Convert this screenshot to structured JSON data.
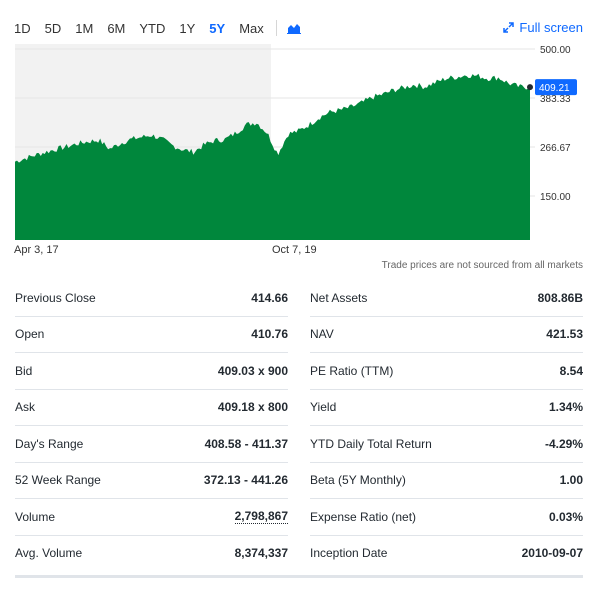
{
  "range_buttons": [
    "1D",
    "5D",
    "1M",
    "6M",
    "YTD",
    "1Y",
    "5Y",
    "Max"
  ],
  "active_range": "5Y",
  "fullscreen_label": "Full screen",
  "disclaimer": "Trade prices are not sourced from all markets",
  "chart_data": {
    "type": "area",
    "x_tick_labels": [
      "Apr 3, 17",
      "Oct 7, 19"
    ],
    "y_ticks": [
      150.0,
      266.67,
      383.33,
      500.0
    ],
    "y_tick_labels": [
      "150.00",
      "266.67",
      "383.33",
      "500.00"
    ],
    "ylim": [
      0,
      500
    ],
    "current_price_label": "409.21",
    "current_price": 409.21,
    "series": [
      {
        "values": [
          232,
          240,
          248,
          255,
          262,
          268,
          275,
          280,
          283,
          262,
          275,
          285,
          290,
          295,
          285,
          270,
          260,
          255,
          272,
          282,
          285,
          300,
          320,
          325,
          300,
          250,
          298,
          305,
          320,
          338,
          350,
          355,
          362,
          372,
          385,
          392,
          402,
          408,
          415,
          410,
          420,
          430,
          433,
          438,
          436,
          430,
          432,
          418,
          410,
          409
        ]
      }
    ],
    "color": "#00873c"
  },
  "stats_left": [
    {
      "label": "Previous Close",
      "value": "414.66"
    },
    {
      "label": "Open",
      "value": "410.76"
    },
    {
      "label": "Bid",
      "value": "409.03 x 900"
    },
    {
      "label": "Ask",
      "value": "409.18 x 800"
    },
    {
      "label": "Day's Range",
      "value": "408.58 - 411.37"
    },
    {
      "label": "52 Week Range",
      "value": "372.13 - 441.26"
    },
    {
      "label": "Volume",
      "value": "2,798,867"
    },
    {
      "label": "Avg. Volume",
      "value": "8,374,337"
    }
  ],
  "stats_right": [
    {
      "label": "Net Assets",
      "value": "808.86B"
    },
    {
      "label": "NAV",
      "value": "421.53"
    },
    {
      "label": "PE Ratio (TTM)",
      "value": "8.54"
    },
    {
      "label": "Yield",
      "value": "1.34%"
    },
    {
      "label": "YTD Daily Total Return",
      "value": "-4.29%"
    },
    {
      "label": "Beta (5Y Monthly)",
      "value": "1.00"
    },
    {
      "label": "Expense Ratio (net)",
      "value": "0.03%"
    },
    {
      "label": "Inception Date",
      "value": "2010-09-07"
    }
  ]
}
